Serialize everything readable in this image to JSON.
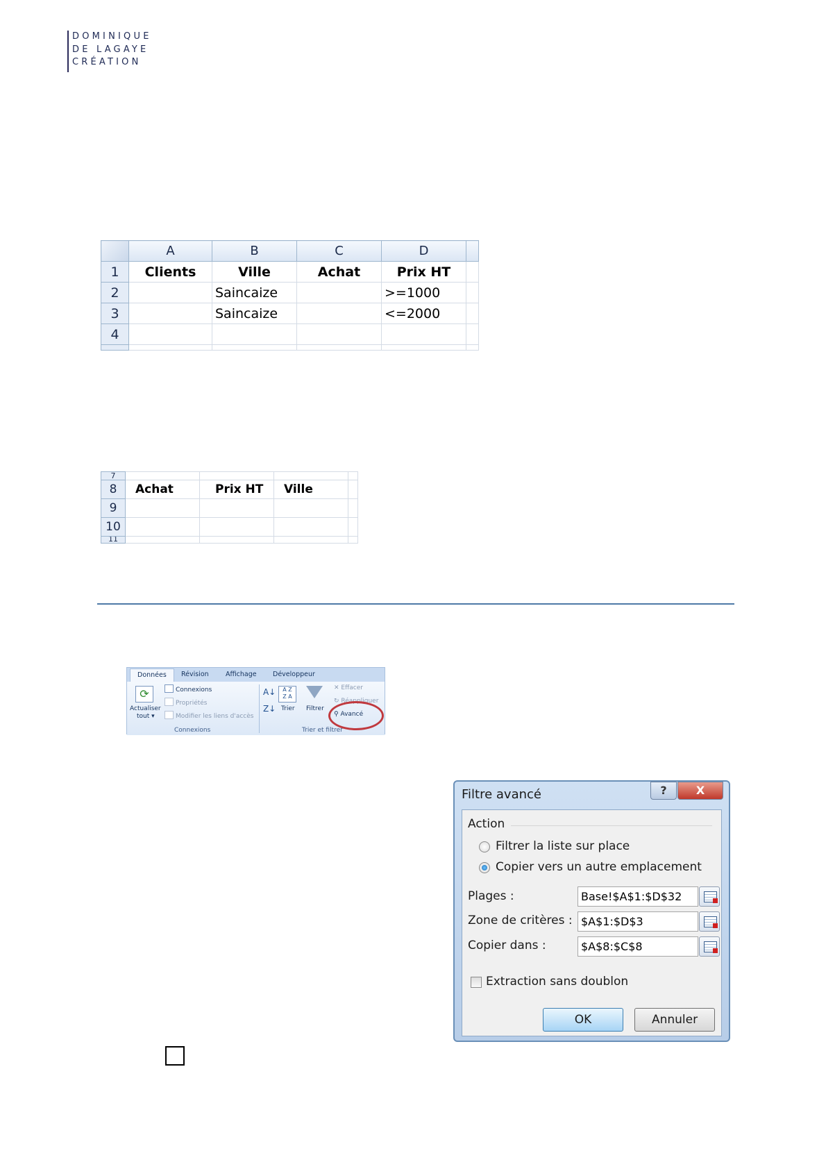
{
  "logo": {
    "lines": [
      "DOMINIQUE",
      "DE LAGAYE",
      "CRÉATION"
    ]
  },
  "sheet1": {
    "columns": [
      "A",
      "B",
      "C",
      "D"
    ],
    "rows": [
      {
        "num": "1",
        "cells": [
          "Clients",
          "Ville",
          "Achat",
          "Prix HT"
        ]
      },
      {
        "num": "2",
        "cells": [
          "",
          "Saincaize",
          "",
          ">=1000"
        ]
      },
      {
        "num": "3",
        "cells": [
          "",
          "Saincaize",
          "",
          "<=2000"
        ]
      },
      {
        "num": "4",
        "cells": [
          "",
          "",
          "",
          ""
        ]
      }
    ]
  },
  "sheet2": {
    "rows": [
      {
        "num": "7",
        "cells": [
          "",
          "",
          ""
        ]
      },
      {
        "num": "8",
        "cells": [
          "Achat",
          "Prix HT",
          "Ville"
        ]
      },
      {
        "num": "9",
        "cells": [
          "",
          "",
          ""
        ]
      },
      {
        "num": "10",
        "cells": [
          "",
          "",
          ""
        ]
      },
      {
        "num": "11",
        "cells": [
          "",
          "",
          ""
        ]
      }
    ]
  },
  "ribbon": {
    "tabs": [
      "Données",
      "Révision",
      "Affichage",
      "Développeur"
    ],
    "refresh_label_1": "Actualiser",
    "refresh_label_2": "tout ▾",
    "connexions": "Connexions",
    "proprietes": "Propriétés",
    "modifier_liens": "Modifier les liens d'accès",
    "group_connexions": "Connexions",
    "trier": "Trier",
    "filtrer": "Filtrer",
    "effacer": "Effacer",
    "reappliquer": "Réappliquer",
    "avance": "Avancé",
    "group_trier": "Trier et filtrer"
  },
  "dialog": {
    "title": "Filtre avancé",
    "help": "?",
    "close": "X",
    "action_label": "Action",
    "radio1": "Filtrer la liste sur place",
    "radio2": "Copier vers un autre emplacement",
    "selected_radio": 2,
    "plages_label": "Plages :",
    "plages_value": "Base!$A$1:$D$32",
    "criteres_label": "Zone de critères :",
    "criteres_value": "$A$1:$D$3",
    "copier_label": "Copier dans :",
    "copier_value": "$A$8:$C$8",
    "sans_doublon": "Extraction sans doublon",
    "ok": "OK",
    "annuler": "Annuler"
  }
}
